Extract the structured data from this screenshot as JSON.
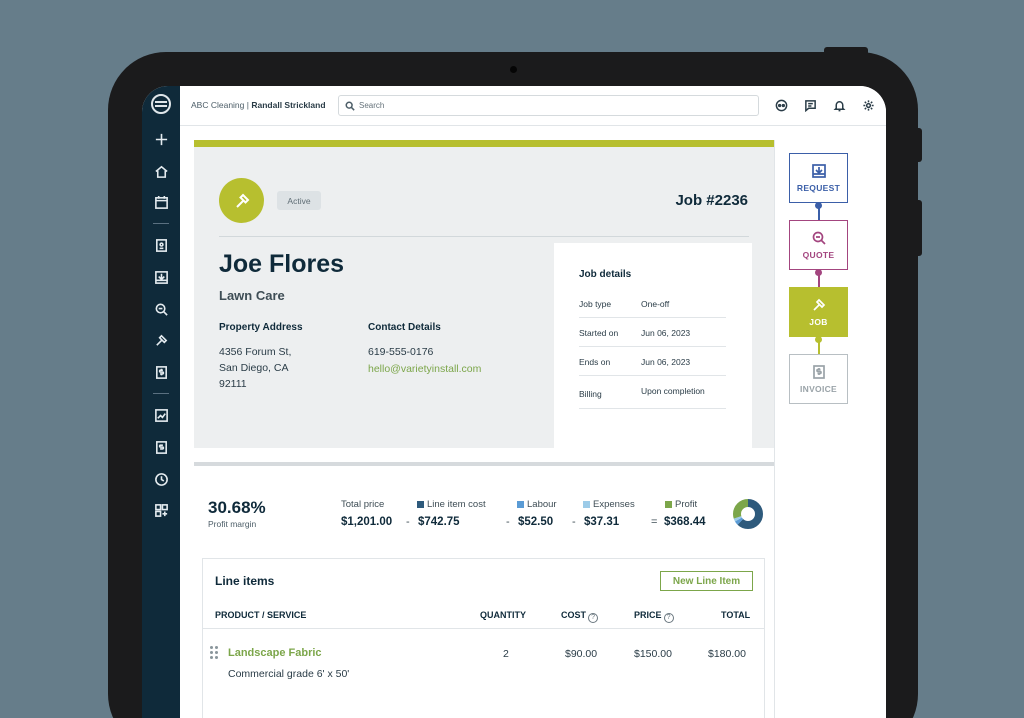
{
  "topbar": {
    "company": "ABC Cleaning",
    "separator": "|",
    "user": "Randall Strickland",
    "search_placeholder": "Search"
  },
  "job": {
    "status": "Active",
    "number": "Job #2236",
    "client_name": "Joe Flores",
    "service": "Lawn Care",
    "property_address_label": "Property Address",
    "address_line1": "4356 Forum St,",
    "address_line2": "San Diego, CA",
    "address_line3": "92111",
    "contact_label": "Contact Details",
    "phone": "619-555-0176",
    "email": "hello@varietyinstall.com"
  },
  "job_details": {
    "title": "Job details",
    "rows": [
      {
        "key": "Job type",
        "value": "One-off"
      },
      {
        "key": "Started on",
        "value": "Jun 06, 2023"
      },
      {
        "key": "Ends on",
        "value": "Jun 06, 2023"
      },
      {
        "key": "Billing",
        "value": "Upon completion"
      }
    ]
  },
  "profit": {
    "margin": "30.68%",
    "margin_label": "Profit margin",
    "total_price_label": "Total price",
    "total_price": "$1,201.00",
    "line_item_cost_label": "Line item cost",
    "line_item_cost": "$742.75",
    "labour_label": "Labour",
    "labour": "$52.50",
    "expenses_label": "Expenses",
    "expenses": "$37.31",
    "profit_label": "Profit",
    "profit": "$368.44",
    "op_minus": "-",
    "op_equals": "=",
    "colors": {
      "line_item_cost": "#2e5a7c",
      "labour": "#5a9bd5",
      "expenses": "#9ccbe8",
      "profit": "#7ca64a"
    }
  },
  "line_items": {
    "title": "Line items",
    "new_button": "New Line Item",
    "headers": {
      "product": "PRODUCT / SERVICE",
      "quantity": "QUANTITY",
      "cost": "COST",
      "price": "PRICE",
      "total": "TOTAL",
      "help": "?"
    },
    "rows": [
      {
        "name": "Landscape Fabric",
        "description": "Commercial grade 6' x 50'",
        "quantity": "2",
        "cost": "$90.00",
        "price": "$150.00",
        "total": "$180.00"
      }
    ]
  },
  "workflow": {
    "steps": [
      {
        "label": "REQUEST",
        "color": "#3b5fa8"
      },
      {
        "label": "QUOTE",
        "color": "#a3457f"
      },
      {
        "label": "JOB",
        "color": "#b7bf2f"
      },
      {
        "label": "INVOICE",
        "color": "#9aa3a8"
      }
    ]
  }
}
